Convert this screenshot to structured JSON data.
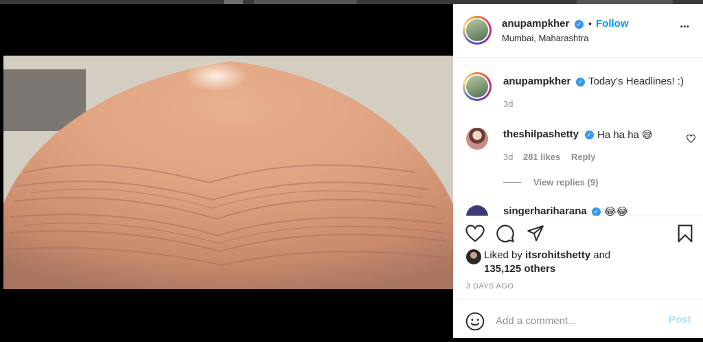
{
  "post": {
    "author": "anupampkher",
    "follow_label": "Follow",
    "separator": "•",
    "location": "Mumbai, Maharashtra",
    "more_label": "•••"
  },
  "caption": {
    "author": "anupampkher",
    "text": "Today’s Headlines! :)",
    "time": "3d"
  },
  "comments": [
    {
      "author": "theshilpashetty",
      "text": "Ha ha ha 😅",
      "time": "3d",
      "likes": "281 likes",
      "reply_label": "Reply",
      "view_replies": "View replies (9)"
    },
    {
      "author": "singerhariharana",
      "text": "😂😂"
    }
  ],
  "likes": {
    "prefix": "Liked by",
    "user": "itsrohitshetty",
    "and": "and",
    "count": "135,125 others"
  },
  "posted": "3 DAYS AGO",
  "composer": {
    "placeholder": "Add a comment...",
    "post_label": "Post"
  },
  "icons": {
    "verified": "verified-badge-icon",
    "heart": "heart-icon",
    "comment": "comment-icon",
    "share": "share-icon",
    "save": "bookmark-icon",
    "emoji": "emoji-icon"
  },
  "colors": {
    "link": "#0095f6",
    "verified": "#3897f0",
    "muted": "#8e8e8e",
    "post_disabled": "#b2dffc"
  }
}
